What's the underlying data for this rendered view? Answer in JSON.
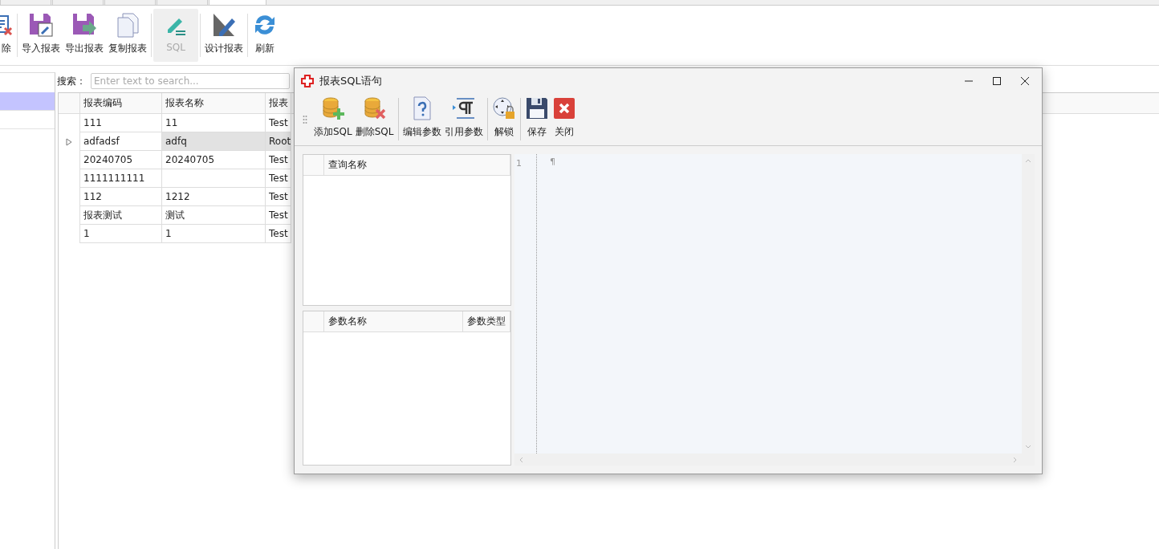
{
  "tabs": [
    {
      "selected": false
    },
    {
      "selected": false
    },
    {
      "selected": false
    },
    {
      "selected": false
    },
    {
      "selected": true
    }
  ],
  "toolbar": [
    {
      "kind": "delete",
      "label": "除",
      "disabled": false
    },
    {
      "kind": "import",
      "label": "导入报表",
      "disabled": false
    },
    {
      "kind": "export",
      "label": "导出报表",
      "disabled": false
    },
    {
      "kind": "copy",
      "label": "复制报表",
      "disabled": false
    },
    {
      "kind": "sql",
      "label": "SQL",
      "disabled": true
    },
    {
      "kind": "design",
      "label": "设计报表",
      "disabled": false
    },
    {
      "kind": "refresh",
      "label": "刷新",
      "disabled": false
    }
  ],
  "side_items": [
    {
      "selected": true
    },
    {
      "selected": false
    }
  ],
  "search": {
    "label": "搜索：",
    "placeholder": "Enter text to search..."
  },
  "table": {
    "columns": [
      "报表编码",
      "报表名称",
      "报表"
    ],
    "rows": [
      {
        "cells": [
          "111",
          "11",
          "Test"
        ],
        "selected": false
      },
      {
        "cells": [
          "adfadsf",
          "adfq",
          "Root"
        ],
        "selected": true
      },
      {
        "cells": [
          "20240705",
          "20240705",
          "Test"
        ],
        "selected": false
      },
      {
        "cells": [
          "1111111111",
          "",
          "Test"
        ],
        "selected": false
      },
      {
        "cells": [
          "112",
          "1212",
          "Test"
        ],
        "selected": false
      },
      {
        "cells": [
          "报表测试",
          "测试",
          "Test"
        ],
        "selected": false
      },
      {
        "cells": [
          "1",
          "1",
          "Test"
        ],
        "selected": false
      }
    ]
  },
  "dialog": {
    "title": "报表SQL语句",
    "toolbar_groups": [
      [
        {
          "kind": "add-db",
          "label": "添加SQL"
        },
        {
          "kind": "del-db",
          "label": "删除SQL"
        }
      ],
      [
        {
          "kind": "help-doc",
          "label": "编辑参数"
        },
        {
          "kind": "pilcrow",
          "label": "引用参数"
        }
      ],
      [
        {
          "kind": "unlock",
          "label": "解锁"
        }
      ],
      [
        {
          "kind": "save",
          "label": "保存"
        },
        {
          "kind": "close",
          "label": "关闭"
        }
      ]
    ],
    "query_grid": {
      "columns": [
        "查询名称"
      ]
    },
    "param_grid": {
      "columns": [
        "参数名称",
        "参数类型"
      ]
    },
    "editor": {
      "line_numbers": [
        "1"
      ],
      "mark": "¶"
    }
  }
}
